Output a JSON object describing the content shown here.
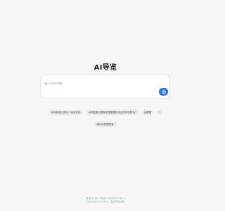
{
  "page": {
    "title": "AI导览"
  },
  "search": {
    "placeholder": "输入任何问题",
    "submit_icon": "submit-arrow-icon"
  },
  "suggestions": {
    "row1": [
      {
        "label": "深圳盐家区有多少电话安排"
      },
      {
        "label": "深圳盐家区哪家餐馆是国际化区的风俗特色?"
      },
      {
        "label": "我要看"
      },
      {
        "label": "!"
      }
    ],
    "row2": [
      {
        "label": "深圳去哪里看海?"
      }
    ]
  },
  "footer": {
    "link_text": "备案号:粤ICP备2023000000号-4",
    "copyright": "Copyright © 2024 · 保留所有权利"
  },
  "colors": {
    "accent": "#2a7ae2",
    "background": "#f6f6f6",
    "footer_link": "#7cc1b6"
  }
}
